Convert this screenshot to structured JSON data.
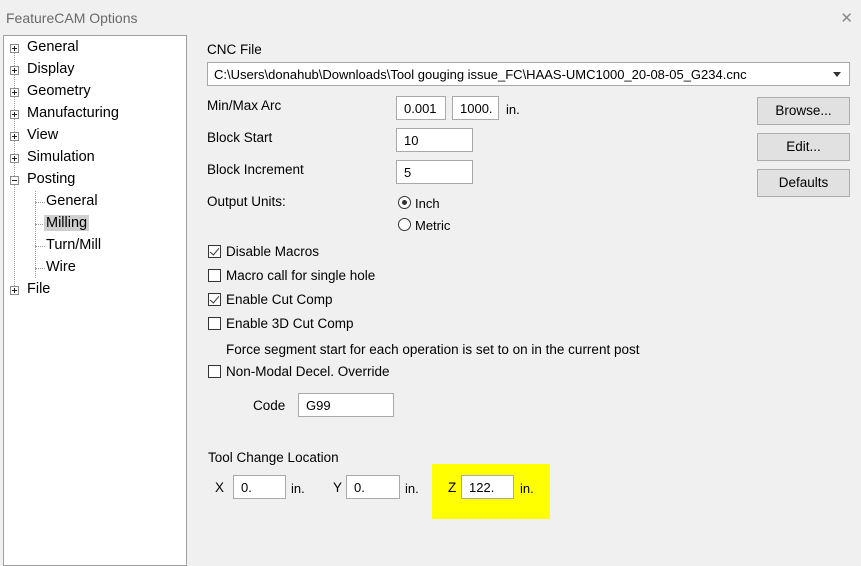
{
  "window": {
    "title": "FeatureCAM Options"
  },
  "tree": {
    "general": "General",
    "display": "Display",
    "geometry": "Geometry",
    "manufacturing": "Manufacturing",
    "view": "View",
    "simulation": "Simulation",
    "posting": "Posting",
    "posting_children": [
      "General",
      "Milling",
      "Turn/Mill",
      "Wire"
    ],
    "file": "File"
  },
  "cnc": {
    "label": "CNC File",
    "path": "C:\\Users\\donahub\\Downloads\\Tool gouging issue_FC\\HAAS-UMC1000_20-08-05_G234.cnc"
  },
  "arc": {
    "label": "Min/Max Arc",
    "min": "0.001",
    "max": "1000.",
    "unit": "in."
  },
  "block_start": {
    "label": "Block Start",
    "value": "10"
  },
  "block_increment": {
    "label": "Block Increment",
    "value": "5"
  },
  "output_units": {
    "label": "Output Units:",
    "inch": "Inch",
    "metric": "Metric",
    "selected": "Inch"
  },
  "buttons": {
    "browse": "Browse...",
    "edit": "Edit...",
    "defaults": "Defaults"
  },
  "options": {
    "disable_macros": {
      "label": "Disable Macros",
      "checked": true
    },
    "macro_single_hole": {
      "label": "Macro call for single hole",
      "checked": false
    },
    "enable_cut_comp": {
      "label": "Enable Cut Comp",
      "checked": true
    },
    "enable_3d_cut_comp": {
      "label": "Enable 3D Cut Comp",
      "checked": false
    },
    "force_segment_note": "Force segment start for each operation is set to on in the current post",
    "non_modal_decel": {
      "label": "Non-Modal Decel. Override",
      "checked": false
    }
  },
  "code": {
    "label": "Code",
    "value": "G99"
  },
  "tool_change": {
    "label": "Tool Change Location",
    "x_label": "X",
    "x_value": "0.",
    "x_unit": "in.",
    "y_label": "Y",
    "y_value": "0.",
    "y_unit": "in.",
    "z_label": "Z",
    "z_value": "122.",
    "z_unit": "in."
  },
  "colors": {
    "highlight": "#ffff00",
    "tree_selected": "#cfcfcf"
  }
}
